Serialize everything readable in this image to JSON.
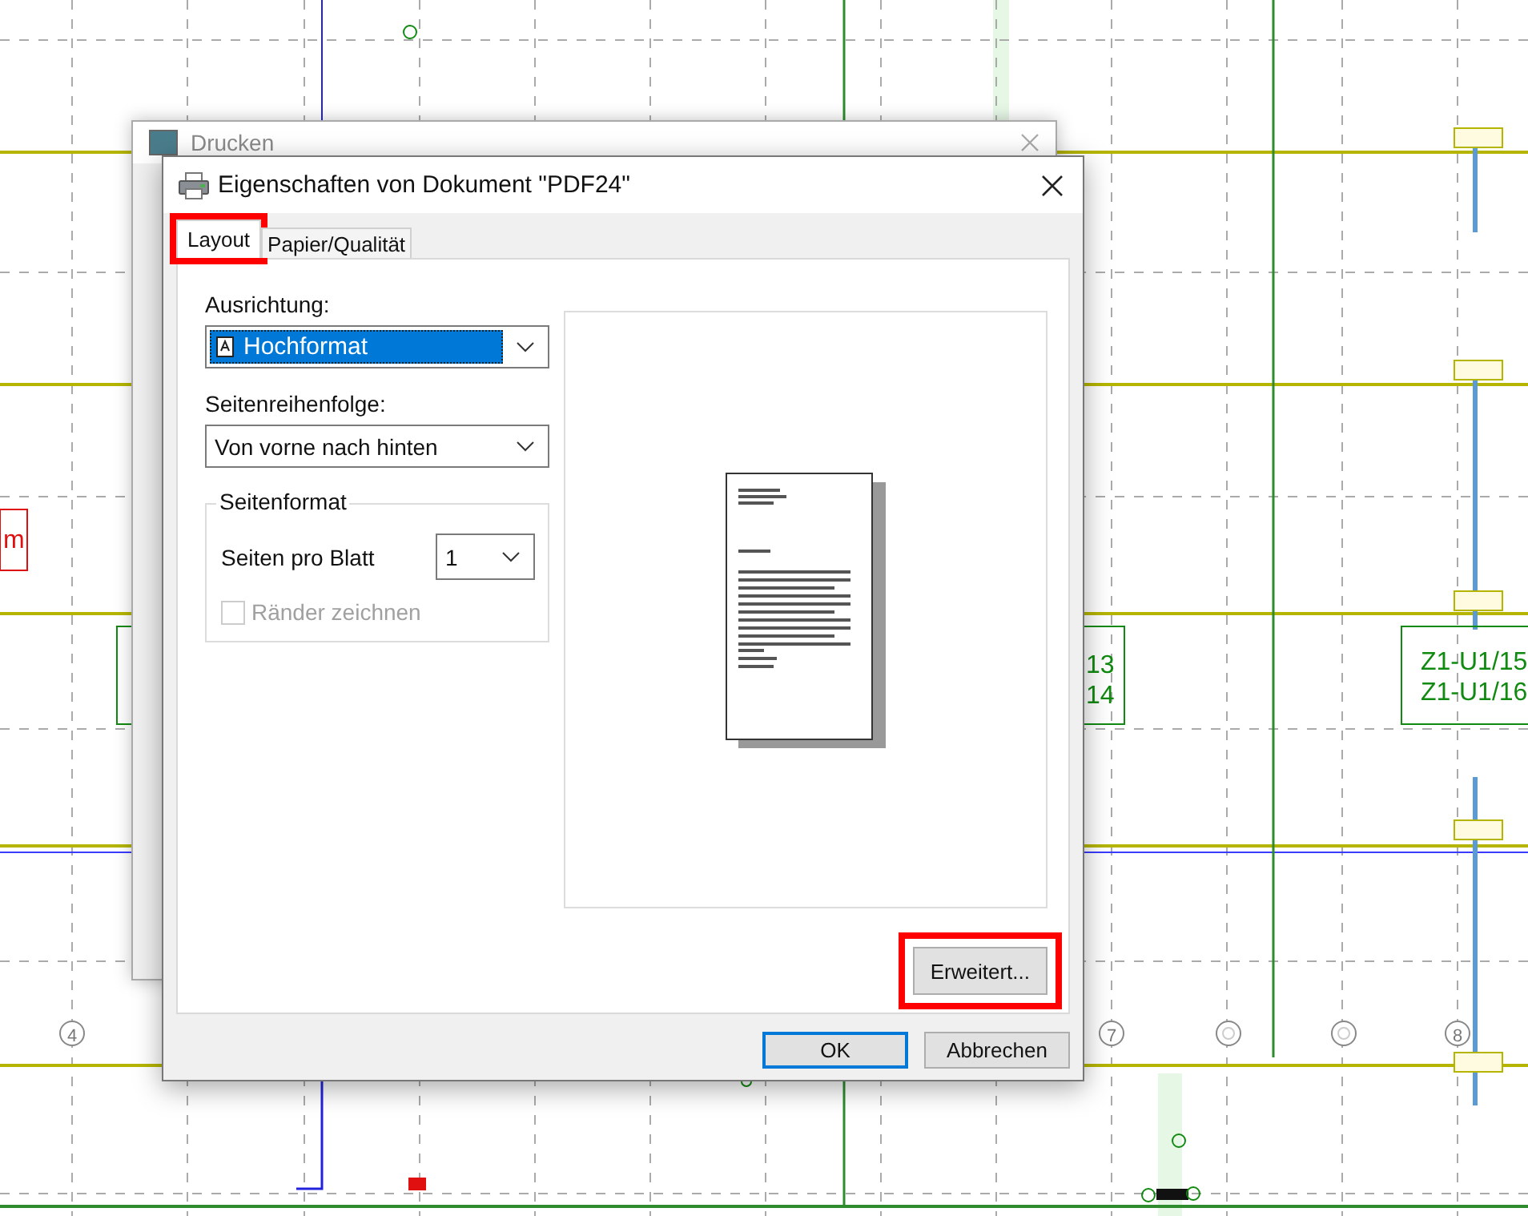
{
  "canvas": {
    "labels": [
      {
        "text": "m",
        "kind": "red"
      },
      {
        "text": "13",
        "kind": "green"
      },
      {
        "text": "14",
        "kind": "green"
      },
      {
        "text": "Z1-U1/15",
        "kind": "green"
      },
      {
        "text": "Z1-U1/16",
        "kind": "green"
      }
    ],
    "grid_circles": [
      {
        "kind": "numbered",
        "text": "4"
      },
      {
        "kind": "numbered",
        "text": "7"
      },
      {
        "kind": "blank"
      },
      {
        "kind": "blank"
      },
      {
        "kind": "numbered",
        "text": "8"
      }
    ]
  },
  "back_window": {
    "title": "Drucken"
  },
  "dialog": {
    "title": "Eigenschaften von Dokument \"PDF24\"",
    "tabs": [
      {
        "label": "Layout",
        "selected": true,
        "highlighted": true
      },
      {
        "label": "Papier/Qualität",
        "selected": false,
        "highlighted": false
      }
    ],
    "orientation": {
      "label": "Ausrichtung:",
      "value": "Hochformat"
    },
    "page_order": {
      "label": "Seitenreihenfolge:",
      "value": "Von vorne nach hinten"
    },
    "page_format": {
      "legend": "Seitenformat",
      "pages_per_sheet_label": "Seiten pro Blatt",
      "pages_per_sheet_value": "1",
      "draw_borders": {
        "label": "Ränder zeichnen",
        "checked": false,
        "disabled": true
      }
    },
    "advanced_button": {
      "label": "Erweitert...",
      "highlighted": true
    },
    "buttons": [
      {
        "label": "OK",
        "default": true
      },
      {
        "label": "Abbrechen",
        "default": false
      }
    ]
  }
}
